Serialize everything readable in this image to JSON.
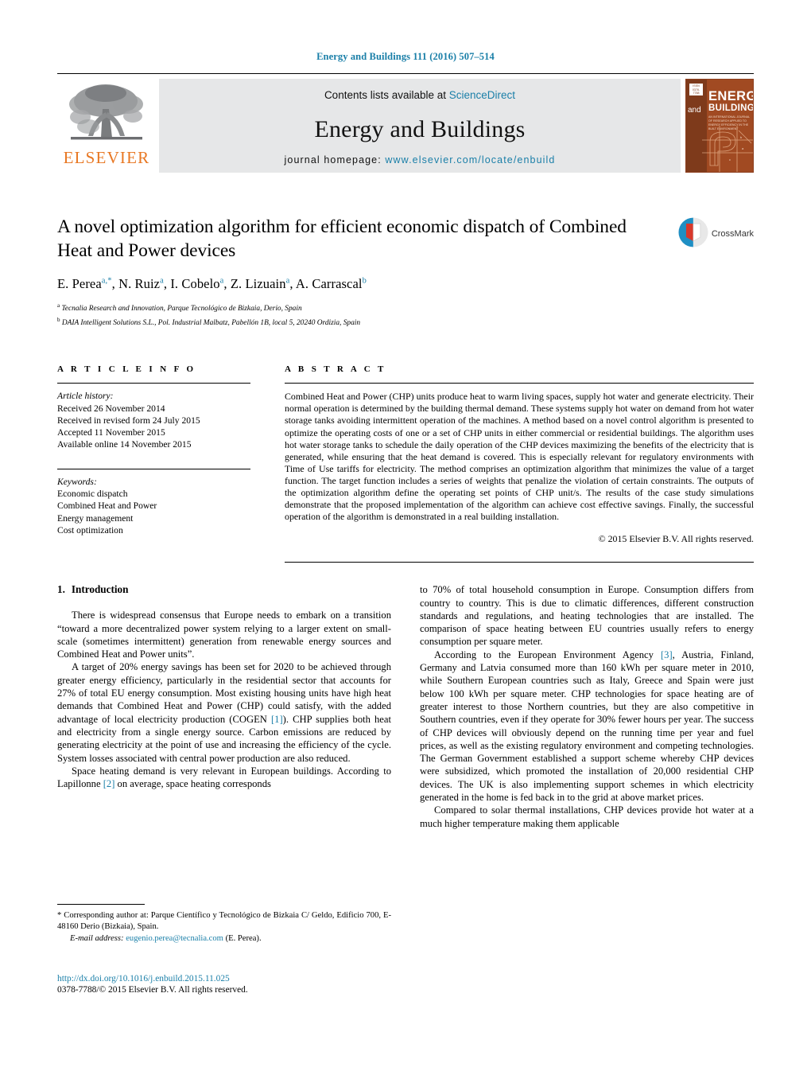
{
  "running_head": "Energy and Buildings 111 (2016) 507–514",
  "masthead": {
    "publisher_name": "ELSEVIER",
    "contents_prefix": "Contents lists available at ",
    "contents_link": "ScienceDirect",
    "journal_title": "Energy and Buildings",
    "homepage_prefix": "journal homepage: ",
    "homepage_url": "www.elsevier.com/locate/enbuild",
    "cover": {
      "brand_top": "ENERGY",
      "brand_and": "and",
      "brand_bottom": "BUILDINGS",
      "cover_sub": "AN INTERNATIONAL JOURNAL OF RESEARCH APPLIED TO ENERGY EFFICIENCY IN THE BUILT ENVIRONMENT",
      "logo_text": "ISSN 0378-7788"
    }
  },
  "article": {
    "title": "A novel optimization algorithm for efficient economic dispatch of Combined Heat and Power devices",
    "authors": [
      {
        "name": "E. Perea",
        "marks": "a,*"
      },
      {
        "name": "N. Ruiz",
        "marks": "a"
      },
      {
        "name": "I. Cobelo",
        "marks": "a"
      },
      {
        "name": "Z. Lizuain",
        "marks": "a"
      },
      {
        "name": "A. Carrascal",
        "marks": "b"
      }
    ],
    "affiliations": [
      {
        "mark": "a",
        "text": "Tecnalia Research and Innovation, Parque Tecnológico de Bizkaia, Derio, Spain"
      },
      {
        "mark": "b",
        "text": "DAIA Intelligent Solutions S.L., Pol. Industrial Malbatz, Pabellón 1B, local 5, 20240 Ordizia, Spain"
      }
    ],
    "crossmark_label": "CrossMark"
  },
  "article_info": {
    "heading": "A R T I C L E   I N F O",
    "history_label": "Article history:",
    "history": [
      "Received 26 November 2014",
      "Received in revised form 24 July 2015",
      "Accepted 11 November 2015",
      "Available online 14 November 2015"
    ],
    "keywords_label": "Keywords:",
    "keywords": [
      "Economic dispatch",
      "Combined Heat and Power",
      "Energy management",
      "Cost optimization"
    ]
  },
  "abstract": {
    "heading": "A B S T R A C T",
    "text": "Combined Heat and Power (CHP) units produce heat to warm living spaces, supply hot water and generate electricity. Their normal operation is determined by the building thermal demand. These systems supply hot water on demand from hot water storage tanks avoiding intermittent operation of the machines. A method based on a novel control algorithm is presented to optimize the operating costs of one or a set of CHP units in either commercial or residential buildings. The algorithm uses hot water storage tanks to schedule the daily operation of the CHP devices maximizing the benefits of the electricity that is generated, while ensuring that the heat demand is covered. This is especially relevant for regulatory environments with Time of Use tariffs for electricity. The method comprises an optimization algorithm that minimizes the value of a target function. The target function includes a series of weights that penalize the violation of certain constraints. The outputs of the optimization algorithm define the operating set points of CHP unit/s. The results of the case study simulations demonstrate that the proposed implementation of the algorithm can achieve cost effective savings. Finally, the successful operation of the algorithm is demonstrated in a real building installation.",
    "copyright": "© 2015 Elsevier B.V. All rights reserved."
  },
  "body": {
    "section_number": "1.",
    "section_title": "Introduction",
    "left_paragraphs": [
      "There is widespread consensus that Europe needs to embark on a transition “toward a more decentralized power system relying to a larger extent on small-scale (sometimes intermittent) generation from renewable energy sources and Combined Heat and Power units”.",
      "A target of 20% energy savings has been set for 2020 to be achieved through greater energy efficiency, particularly in the residential sector that accounts for 27% of total EU energy consumption. Most existing housing units have high heat demands that Combined Heat and Power (CHP) could satisfy, with the added advantage of local electricity production (COGEN [1]). CHP supplies both heat and electricity from a single energy source. Carbon emissions are reduced by generating electricity at the point of use and increasing the efficiency of the cycle. System losses associated with central power production are also reduced.",
      "Space heating demand is very relevant in European buildings. According to Lapillonne [2] on average, space heating corresponds"
    ],
    "right_paragraphs": [
      "to 70% of total household consumption in Europe. Consumption differs from country to country. This is due to climatic differences, different construction standards and regulations, and heating technologies that are installed. The comparison of space heating between EU countries usually refers to energy consumption per square meter.",
      "According to the European Environment Agency [3], Austria, Finland, Germany and Latvia consumed more than 160 kWh per square meter in 2010, while Southern European countries such as Italy, Greece and Spain were just below 100 kWh per square meter. CHP technologies for space heating are of greater interest to those Northern countries, but they are also competitive in Southern countries, even if they operate for 30% fewer hours per year. The success of CHP devices will obviously depend on the running time per year and fuel prices, as well as the existing regulatory environment and competing technologies. The German Government established a support scheme whereby CHP devices were subsidized, which promoted the installation of 20,000 residential CHP devices. The UK is also implementing support schemes in which electricity generated in the home is fed back in to the grid at above market prices.",
      "Compared to solar thermal installations, CHP devices provide hot water at a much higher temperature making them applicable"
    ],
    "reference_marks": [
      "[1]",
      "[2]",
      "[3]"
    ]
  },
  "footnotes": {
    "corresponding": "* Corresponding author at: Parque Científico y Tecnológico de Bizkaia C/ Geldo, Edificio 700, E-48160 Derio (Bizkaia), Spain.",
    "email_label": "E-mail address:",
    "email": "eugenio.perea@tecnalia.com",
    "email_suffix": "(E. Perea)."
  },
  "doi": {
    "url": "http://dx.doi.org/10.1016/j.enbuild.2015.11.025",
    "issn_line": "0378-7788/© 2015 Elsevier B.V. All rights reserved."
  },
  "colors": {
    "link_blue": "#1a7fa8",
    "elsevier_orange": "#E87722",
    "band_grey": "#e6e7e8",
    "cover_rust": "#a14a22"
  }
}
